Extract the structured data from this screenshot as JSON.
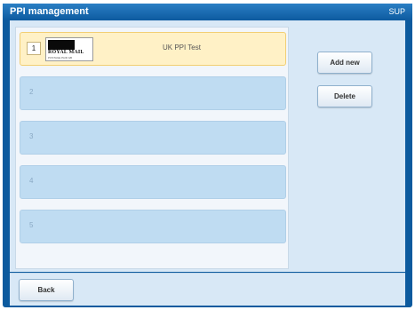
{
  "window": {
    "title": "PPI management",
    "user": "SUP"
  },
  "ppi_list": [
    {
      "number": "1",
      "label": "UK PPI Test",
      "selected": true,
      "logo": {
        "text": "ROYAL MAIL",
        "subtext": "POSTAGE PAID GB"
      }
    },
    {
      "number": "2",
      "label": "",
      "selected": false
    },
    {
      "number": "3",
      "label": "",
      "selected": false
    },
    {
      "number": "4",
      "label": "",
      "selected": false
    },
    {
      "number": "5",
      "label": "",
      "selected": false
    }
  ],
  "actions": {
    "add_new": "Add new",
    "delete": "Delete"
  },
  "footer": {
    "back": "Back"
  }
}
